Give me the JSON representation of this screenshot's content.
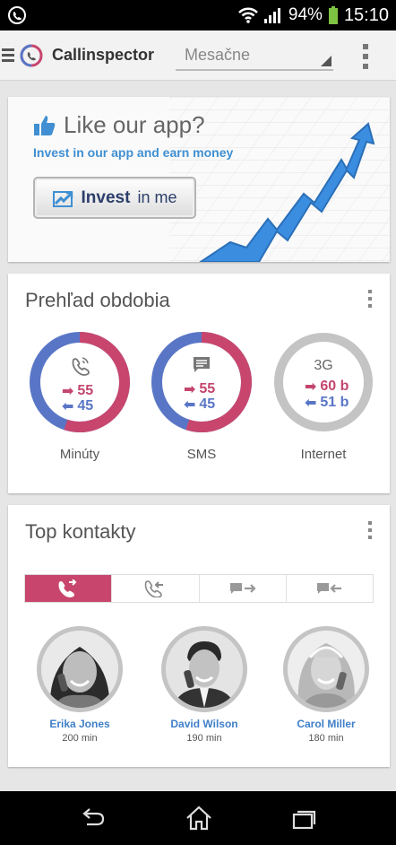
{
  "status_bar": {
    "battery": "94%",
    "time": "15:10"
  },
  "app_bar": {
    "title": "Callinspector",
    "period_value": "Mesačne"
  },
  "promo": {
    "title": "Like our app?",
    "subtitle": "Invest in our app and earn money",
    "button_strong": "Invest",
    "button_light": "in me"
  },
  "overview": {
    "title": "Prehľad obdobia",
    "rings": [
      {
        "label": "Minúty",
        "out": "55",
        "in": "45",
        "out_fraction": 0.55
      },
      {
        "label": "SMS",
        "out": "55",
        "in": "45",
        "out_fraction": 0.55
      },
      {
        "label": "Internet",
        "top": "3G",
        "out": "60 b",
        "in": "51 b"
      }
    ]
  },
  "contacts": {
    "title": "Top kontakty",
    "people": [
      {
        "name": "Erika Jones",
        "minutes": "200 min"
      },
      {
        "name": "David Wilson",
        "minutes": "190 min"
      },
      {
        "name": "Carol Miller",
        "minutes": "180 min"
      }
    ]
  },
  "colors": {
    "accent_pink": "#c8466e",
    "accent_blue": "#5976c6",
    "link_blue": "#3f8fd2"
  }
}
